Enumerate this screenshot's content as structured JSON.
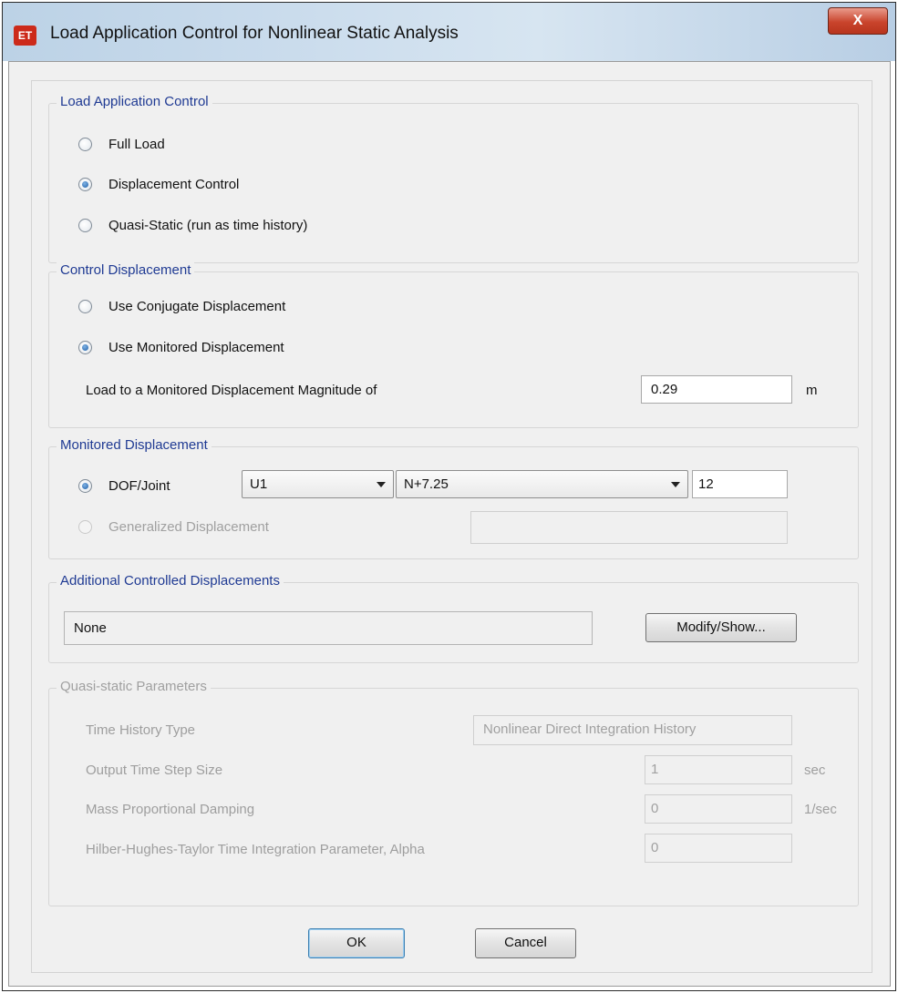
{
  "window": {
    "title": "Load Application Control for Nonlinear Static Analysis",
    "app_icon_text": "ET",
    "close_label": "X"
  },
  "load_application_control": {
    "legend": "Load Application Control",
    "options": [
      {
        "label": "Full Load",
        "checked": false
      },
      {
        "label": "Displacement Control",
        "checked": true
      },
      {
        "label": "Quasi-Static (run as time history)",
        "checked": false
      }
    ]
  },
  "control_displacement": {
    "legend": "Control Displacement",
    "options": [
      {
        "label": "Use Conjugate Displacement",
        "checked": false
      },
      {
        "label": "Use Monitored Displacement",
        "checked": true
      }
    ],
    "magnitude_label": "Load to a Monitored Displacement Magnitude of",
    "magnitude_value": "0.29",
    "magnitude_unit": "m"
  },
  "monitored_displacement": {
    "legend": "Monitored Displacement",
    "dof_joint_label": "DOF/Joint",
    "dof_joint_checked": true,
    "dof_value": "U1",
    "joint_label_value": "N+7.25",
    "joint_number": "12",
    "generalized_label": "Generalized Displacement",
    "generalized_value": ""
  },
  "additional_controlled": {
    "legend": "Additional Controlled Displacements",
    "value": "None",
    "modify_button": "Modify/Show..."
  },
  "quasi_static": {
    "legend": "Quasi-static Parameters",
    "time_history_type_label": "Time History Type",
    "time_history_type_value": "Nonlinear Direct Integration History",
    "output_step_label": "Output Time Step Size",
    "output_step_value": "1",
    "output_step_unit": "sec",
    "mass_damping_label": "Mass Proportional Damping",
    "mass_damping_value": "0",
    "mass_damping_unit": "1/sec",
    "hht_label": "Hilber-Hughes-Taylor Time Integration Parameter, Alpha",
    "hht_value": "0"
  },
  "buttons": {
    "ok": "OK",
    "cancel": "Cancel"
  },
  "colors": {
    "group_legend": "#1f3a93",
    "disabled_text": "#a0a0a0",
    "close_button": "#c9442c"
  }
}
